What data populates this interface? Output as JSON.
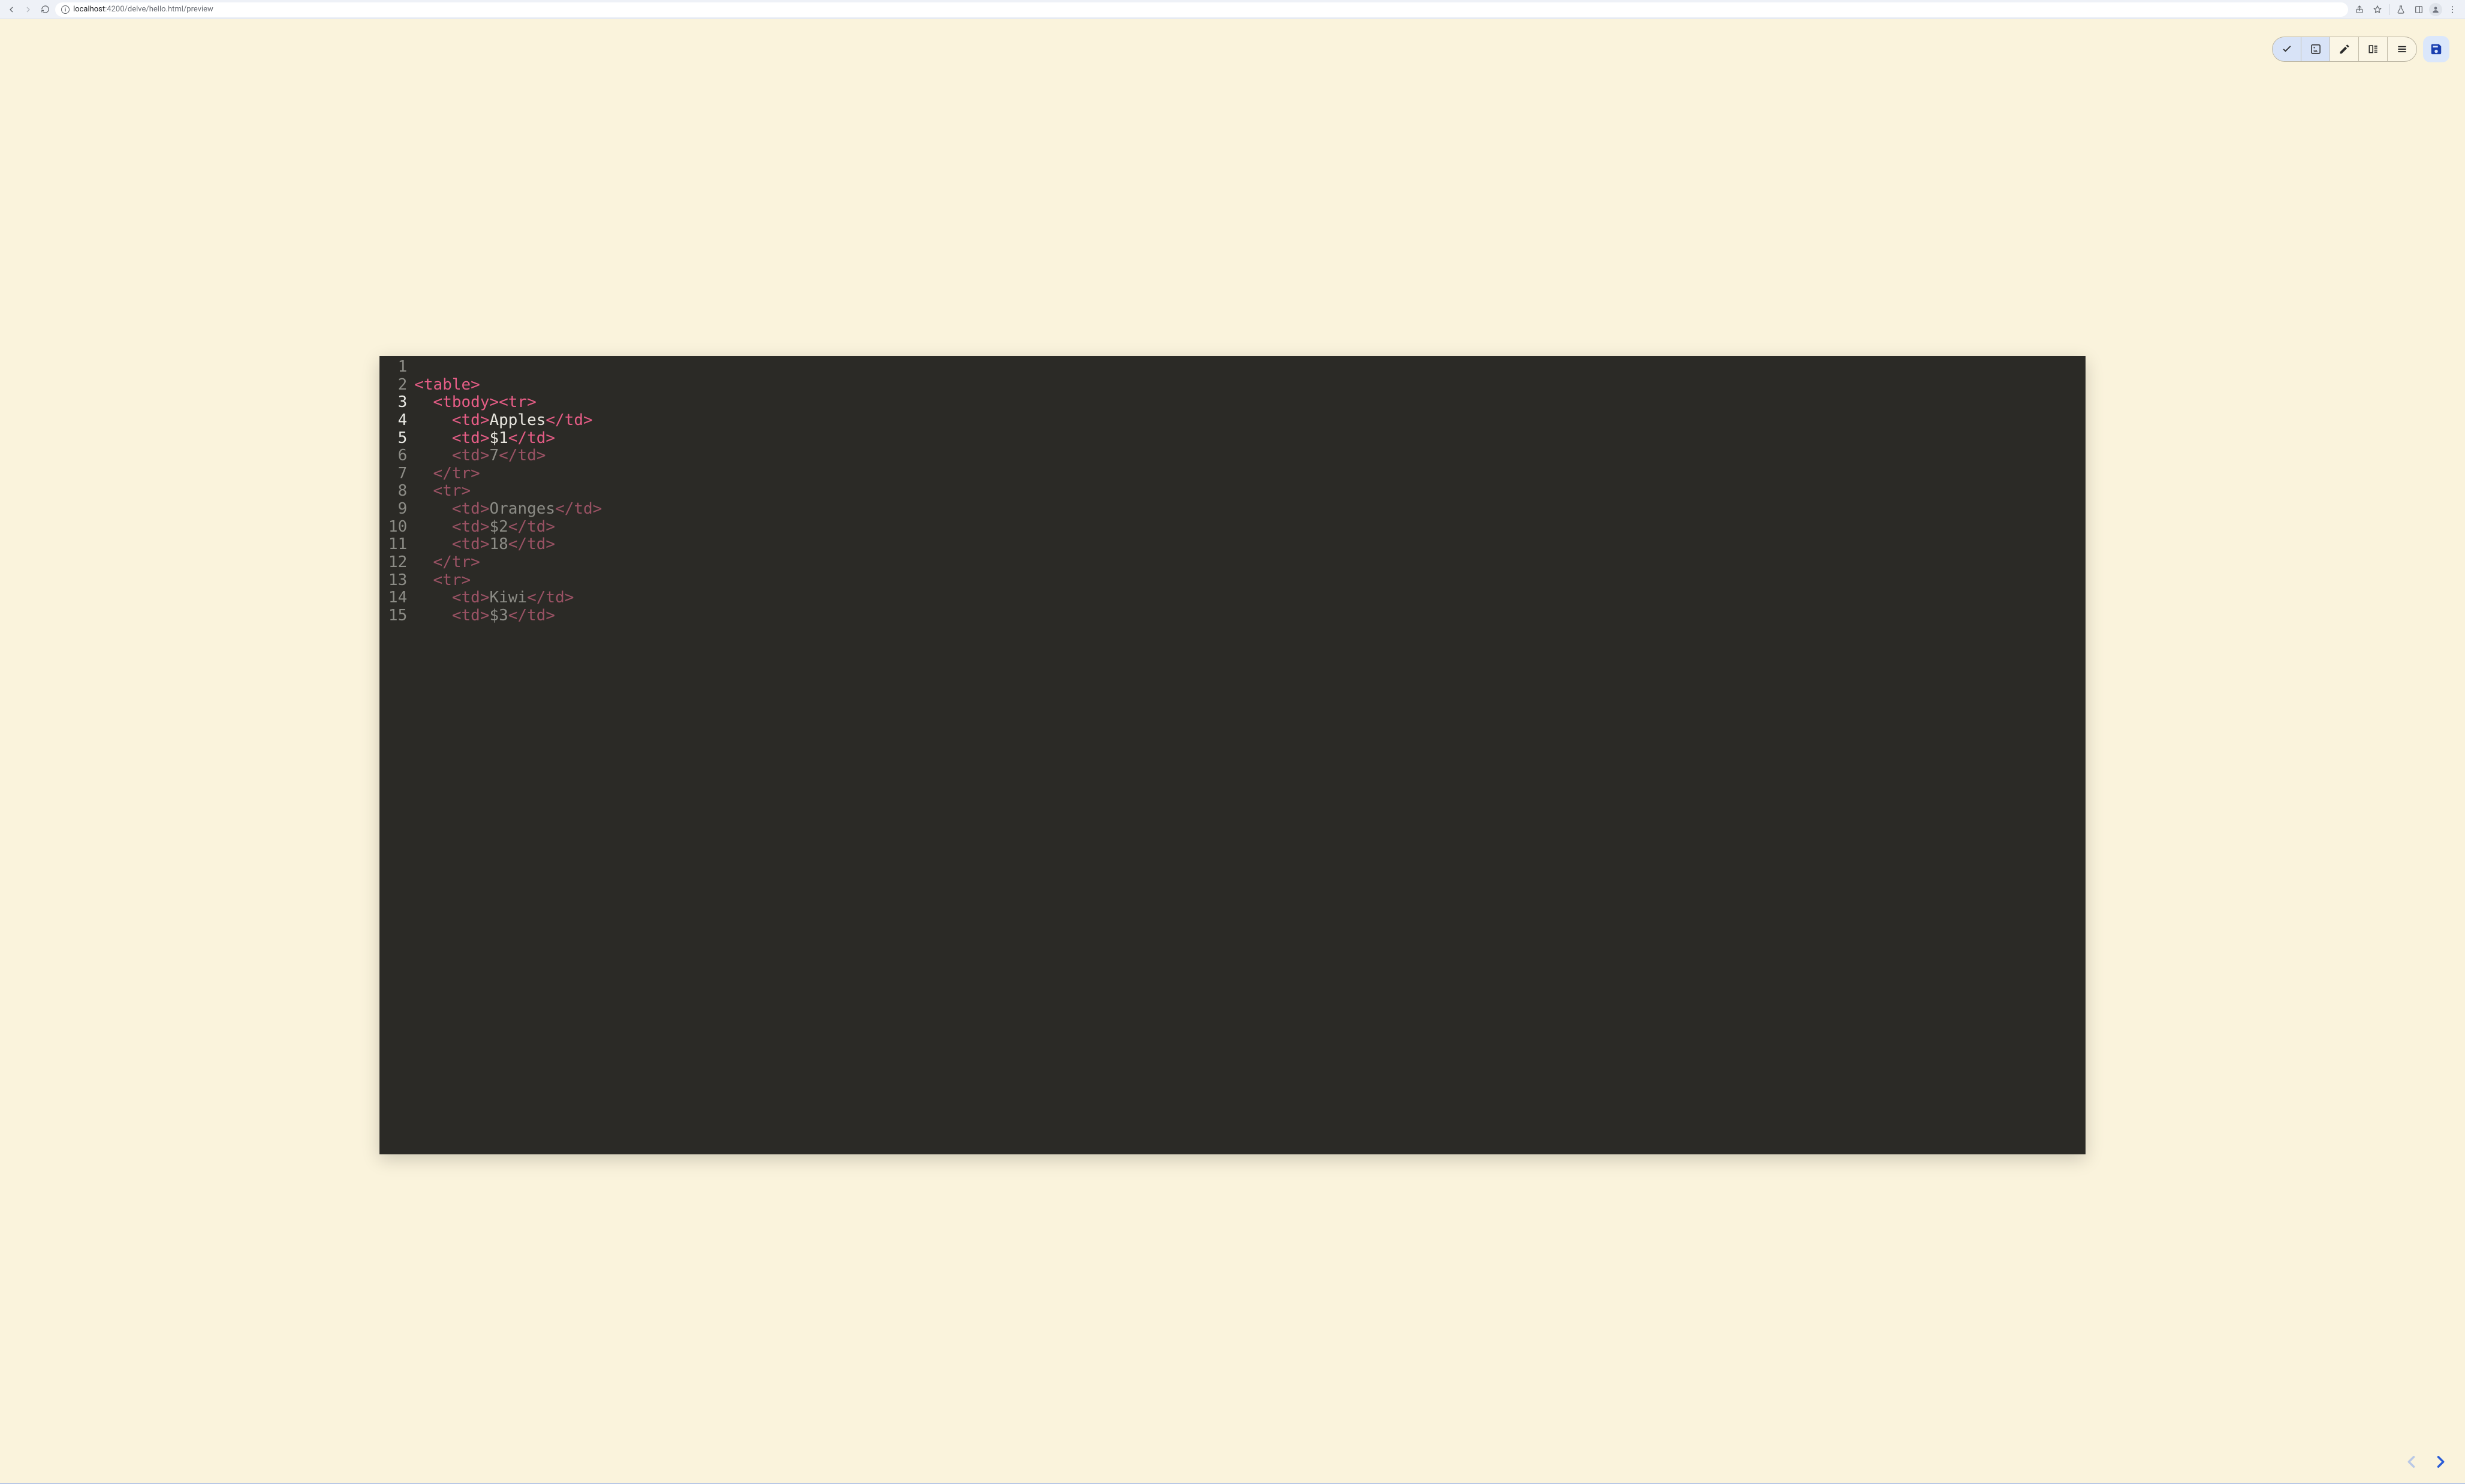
{
  "browser": {
    "url_host": "localhost",
    "url_port": ":4200",
    "url_path": "/delve/hello.html/preview"
  },
  "code": {
    "lines": [
      {
        "n": "1",
        "hl": false,
        "segs": []
      },
      {
        "n": "2",
        "hl": false,
        "segs": [
          {
            "cls": "tag",
            "t": "<table>"
          }
        ]
      },
      {
        "n": "3",
        "hl": true,
        "segs": [
          {
            "cls": "",
            "t": "  "
          },
          {
            "cls": "tag",
            "t": "<tbody><tr>"
          }
        ]
      },
      {
        "n": "4",
        "hl": true,
        "segs": [
          {
            "cls": "",
            "t": "    "
          },
          {
            "cls": "tag",
            "t": "<td>"
          },
          {
            "cls": "",
            "t": "Apples"
          },
          {
            "cls": "tag",
            "t": "</td>"
          }
        ]
      },
      {
        "n": "5",
        "hl": true,
        "segs": [
          {
            "cls": "",
            "t": "    "
          },
          {
            "cls": "tag",
            "t": "<td>"
          },
          {
            "cls": "",
            "t": "$1"
          },
          {
            "cls": "tag",
            "t": "</td>"
          }
        ]
      },
      {
        "n": "6",
        "hl": false,
        "segs": [
          {
            "cls": "",
            "t": "    "
          },
          {
            "cls": "dim-tag",
            "t": "<td>"
          },
          {
            "cls": "dim-txt",
            "t": "7"
          },
          {
            "cls": "dim-tag",
            "t": "</td>"
          }
        ]
      },
      {
        "n": "7",
        "hl": false,
        "segs": [
          {
            "cls": "",
            "t": "  "
          },
          {
            "cls": "dim-tag",
            "t": "</tr>"
          }
        ]
      },
      {
        "n": "8",
        "hl": false,
        "segs": [
          {
            "cls": "",
            "t": "  "
          },
          {
            "cls": "dim-tag",
            "t": "<tr>"
          }
        ]
      },
      {
        "n": "9",
        "hl": false,
        "segs": [
          {
            "cls": "",
            "t": "    "
          },
          {
            "cls": "dim-tag",
            "t": "<td>"
          },
          {
            "cls": "dim-txt",
            "t": "Oranges"
          },
          {
            "cls": "dim-tag",
            "t": "</td>"
          }
        ]
      },
      {
        "n": "10",
        "hl": false,
        "segs": [
          {
            "cls": "",
            "t": "    "
          },
          {
            "cls": "dim-tag",
            "t": "<td>"
          },
          {
            "cls": "dim-txt",
            "t": "$2"
          },
          {
            "cls": "dim-tag",
            "t": "</td>"
          }
        ]
      },
      {
        "n": "11",
        "hl": false,
        "segs": [
          {
            "cls": "",
            "t": "    "
          },
          {
            "cls": "dim-tag",
            "t": "<td>"
          },
          {
            "cls": "dim-txt",
            "t": "18"
          },
          {
            "cls": "dim-tag",
            "t": "</td>"
          }
        ]
      },
      {
        "n": "12",
        "hl": false,
        "segs": [
          {
            "cls": "",
            "t": "  "
          },
          {
            "cls": "dim-tag",
            "t": "</tr>"
          }
        ]
      },
      {
        "n": "13",
        "hl": false,
        "segs": [
          {
            "cls": "",
            "t": "  "
          },
          {
            "cls": "dim-tag",
            "t": "<tr>"
          }
        ]
      },
      {
        "n": "14",
        "hl": false,
        "segs": [
          {
            "cls": "",
            "t": "    "
          },
          {
            "cls": "dim-tag",
            "t": "<td>"
          },
          {
            "cls": "dim-txt",
            "t": "Kiwi"
          },
          {
            "cls": "dim-tag",
            "t": "</td>"
          }
        ]
      },
      {
        "n": "15",
        "hl": false,
        "segs": [
          {
            "cls": "",
            "t": "    "
          },
          {
            "cls": "dim-tag",
            "t": "<td>"
          },
          {
            "cls": "dim-txt",
            "t": "$3"
          },
          {
            "cls": "dim-tag",
            "t": "</td>"
          }
        ]
      }
    ]
  }
}
